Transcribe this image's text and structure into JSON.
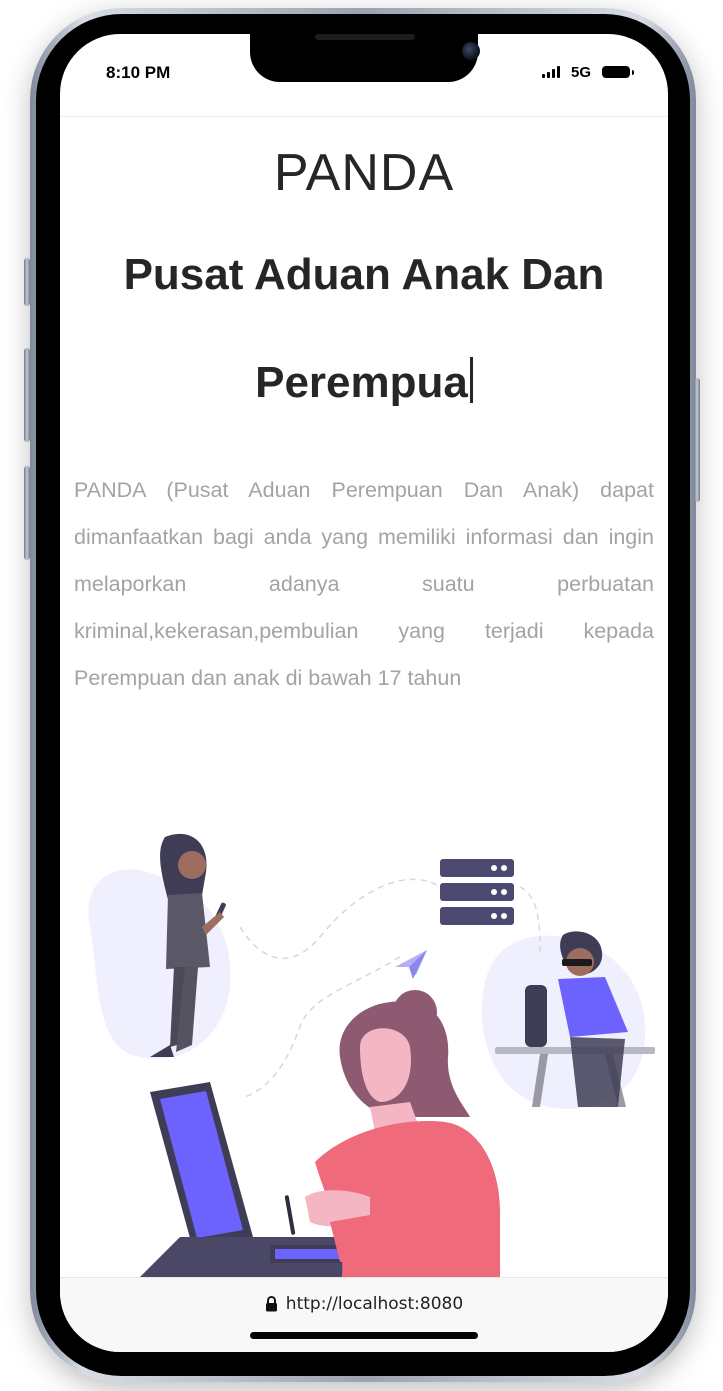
{
  "status_bar": {
    "time": "8:10 PM",
    "network": "5G",
    "signal_icon": "signal-bars-icon",
    "battery_icon": "battery-icon"
  },
  "page": {
    "brand": "PANDA",
    "headline_line1": "Pusat Aduan Anak Dan",
    "headline_line2": "Perempua",
    "description": "PANDA (Pusat Aduan Perempuan Dan Anak) dapat dimanfaatkan bagi anda yang memiliki informasi dan ingin melaporkan adanya suatu perbuatan kriminal,kekerasan,pembulian yang terjadi kepada Perempuan dan anak di bawah 17 tahun",
    "illustration_icon": "reporting-illustration-icon"
  },
  "browser": {
    "url": "http://localhost:8080",
    "lock_icon": "lock-icon"
  },
  "colors": {
    "accent": "#6c63ff",
    "heading": "#262626",
    "body_text": "#a3a3a3",
    "illustration_dark": "#3f3d56",
    "illustration_pink": "#ef6a7a",
    "illustration_hair": "#8e5a72"
  }
}
